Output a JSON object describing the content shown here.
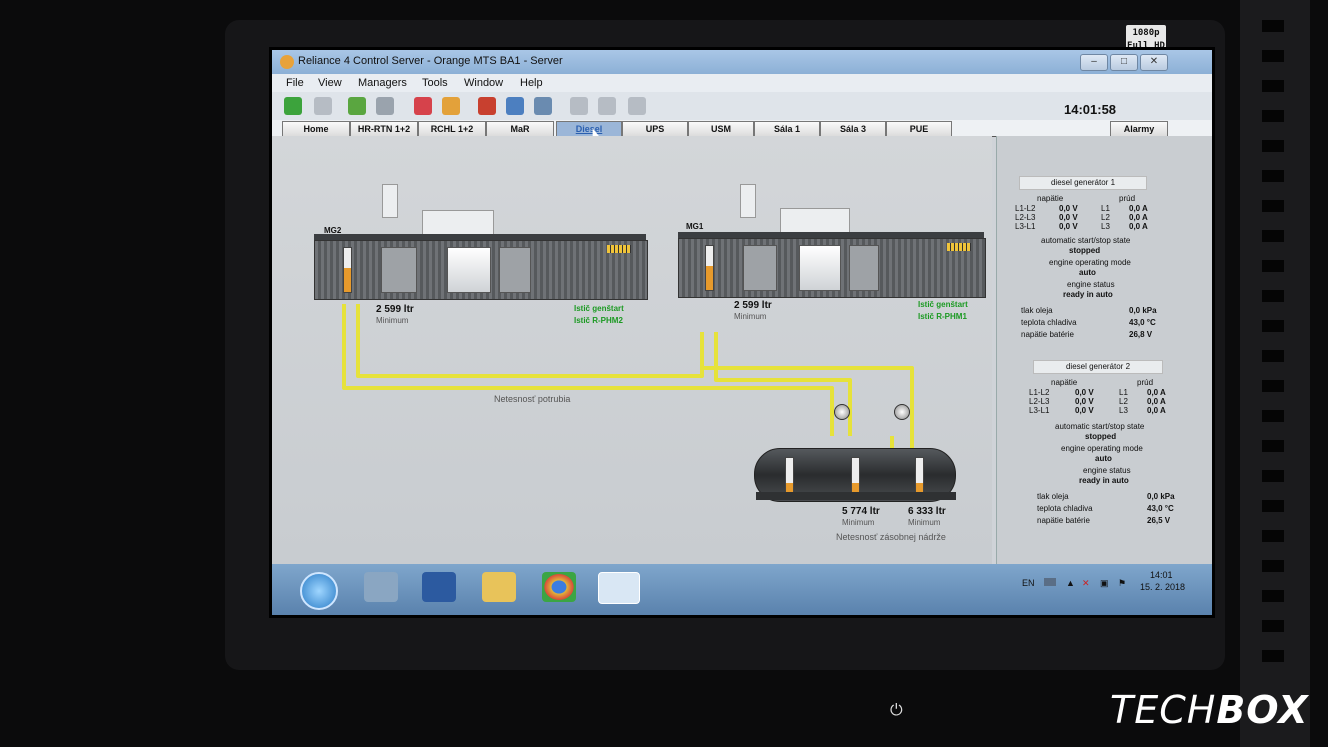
{
  "window": {
    "title": "Reliance 4 Control Server - Orange MTS BA1 - Server",
    "controls": {
      "minimize": "–",
      "maximize": "□",
      "close": "✕"
    }
  },
  "menu": [
    "File",
    "View",
    "Managers",
    "Tools",
    "Window",
    "Help"
  ],
  "toolbar_icons": [
    "back-icon",
    "save-icon",
    "users-icon",
    "user-icon",
    "doc-alarm-icon",
    "doc-warning-icon",
    "chart-icon",
    "db-icon",
    "print-icon",
    "edit-icon",
    "edit2-icon",
    "stamp-icon"
  ],
  "clock": "14:01:58",
  "tabs": [
    "Home",
    "HR-RTN 1+2",
    "RCHL 1+2",
    "MaR",
    "Diesel",
    "UPS",
    "USM",
    "Sála 1",
    "Sála 3",
    "PUE"
  ],
  "active_tab": "Diesel",
  "alarm_tab": "Alarmy",
  "diagram": {
    "mg2": {
      "label": "MG2",
      "level": "2 599 ltr",
      "level_sub": "Minimum",
      "status1": "Istič genštart",
      "status2": "Istič R-PHM2",
      "fill": 0.55
    },
    "mg1": {
      "label": "MG1",
      "level": "2 599 ltr",
      "level_sub": "Minimum",
      "status1": "Istič genštart",
      "status2": "Istič R-PHM1",
      "fill": 0.55
    },
    "pipe_note": "Netesnosť potrubia",
    "tank": {
      "level_left": "5 774 ltr",
      "level_left_sub": "Minimum",
      "level_right": "6 333 ltr",
      "level_right_sub": "Minimum",
      "note": "Netesnosť zásobnej nádrže",
      "fill": 0.35
    }
  },
  "panel": {
    "gen1": {
      "title": "diesel generátor 1",
      "hdr_voltage": "napätie",
      "hdr_current": "prúd",
      "rows": [
        {
          "pair": "L1-L2",
          "v": "0,0 V",
          "phase": "L1",
          "a": "0,0 A"
        },
        {
          "pair": "L2-L3",
          "v": "0,0 V",
          "phase": "L2",
          "a": "0,0 A"
        },
        {
          "pair": "L3-L1",
          "v": "0,0 V",
          "phase": "L3",
          "a": "0,0 A"
        }
      ],
      "auto_label": "automatic start/stop state",
      "auto_value": "stopped",
      "mode_label": "engine operating mode",
      "mode_value": "auto",
      "status_label": "engine status",
      "status_value": "ready in auto",
      "oil_label": "tlak oleja",
      "oil_value": "0,0 kPa",
      "coolant_label": "teplota chladiva",
      "coolant_value": "43,0 °C",
      "battery_label": "napätie batérie",
      "battery_value": "26,8 V"
    },
    "gen2": {
      "title": "diesel generátor 2",
      "hdr_voltage": "napätie",
      "hdr_current": "prúd",
      "rows": [
        {
          "pair": "L1-L2",
          "v": "0,0 V",
          "phase": "L1",
          "a": "0,0 A"
        },
        {
          "pair": "L2-L3",
          "v": "0,0 V",
          "phase": "L2",
          "a": "0,0 A"
        },
        {
          "pair": "L3-L1",
          "v": "0,0 V",
          "phase": "L3",
          "a": "0,0 A"
        }
      ],
      "auto_label": "automatic start/stop state",
      "auto_value": "stopped",
      "mode_label": "engine operating mode",
      "mode_value": "auto",
      "status_label": "engine status",
      "status_value": "ready in auto",
      "oil_label": "tlak oleja",
      "oil_value": "0,0 kPa",
      "coolant_label": "teplota chladiva",
      "coolant_value": "43,0 °C",
      "battery_label": "napätie batérie",
      "battery_value": "26,5 V"
    }
  },
  "taskbar": {
    "apps": [
      "start-icon",
      "server-manager-icon",
      "powershell-icon",
      "explorer-icon",
      "chrome-icon",
      "reliance-icon"
    ],
    "lang": "EN",
    "time": "14:01",
    "date": "15. 2. 2018"
  },
  "overlay": {
    "badge_line1": "1080p",
    "badge_line2": "Full HD",
    "brand_light": "TECH",
    "brand_bold": "BOX"
  },
  "colors": {
    "pipe": "#e6e23a",
    "fuel": "#e79a2c",
    "status_green": "#1b9a22"
  }
}
